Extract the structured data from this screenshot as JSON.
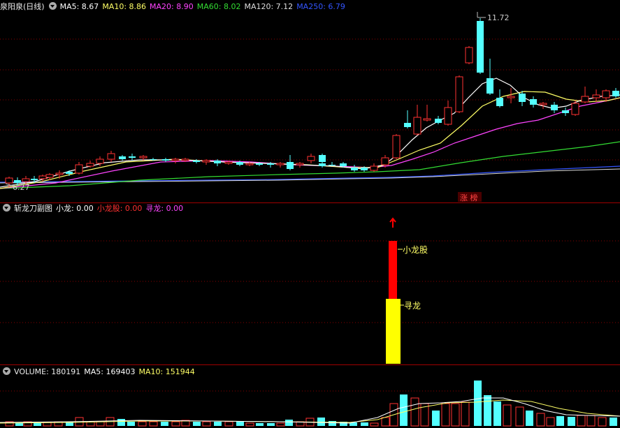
{
  "main_header": {
    "title": "泉阳泉(日线)",
    "items": [
      {
        "label": "MA5: 8.67",
        "color": "#ffffff"
      },
      {
        "label": "MA10: 8.86",
        "color": "#ffff66"
      },
      {
        "label": "MA20: 8.90",
        "color": "#ff44ff"
      },
      {
        "label": "MA60: 8.02",
        "color": "#33dd33"
      },
      {
        "label": "MA120: 7.12",
        "color": "#dddddd"
      },
      {
        "label": "MA250: 6.79",
        "color": "#3355ff"
      }
    ]
  },
  "main_chart": {
    "high_label": "11.72",
    "low_label": "6.27",
    "badge": "涨 榜",
    "colors": {
      "up": "#ff3232",
      "down": "#54ffff",
      "grid": "#8b0000"
    }
  },
  "indicator_header": {
    "title": "斩龙刀副图",
    "items": [
      {
        "label": "小龙: 0.00",
        "color": "#ffffff"
      },
      {
        "label": "小龙股: 0.00",
        "color": "#ff3030"
      },
      {
        "label": "寻龙: 0.00",
        "color": "#ff44ff"
      }
    ]
  },
  "indicator_chart": {
    "bar_label_top": "小龙股",
    "bar_label_bottom": "寻龙",
    "colors": {
      "top": "#ff0000",
      "bottom": "#ffff00",
      "arrow": "#ff0000"
    }
  },
  "volume_header": {
    "title": "VOLUME: 180191",
    "items": [
      {
        "label": "MA5: 169403",
        "color": "#ffffff"
      },
      {
        "label": "MA10: 151944",
        "color": "#ffff66"
      }
    ]
  }
}
